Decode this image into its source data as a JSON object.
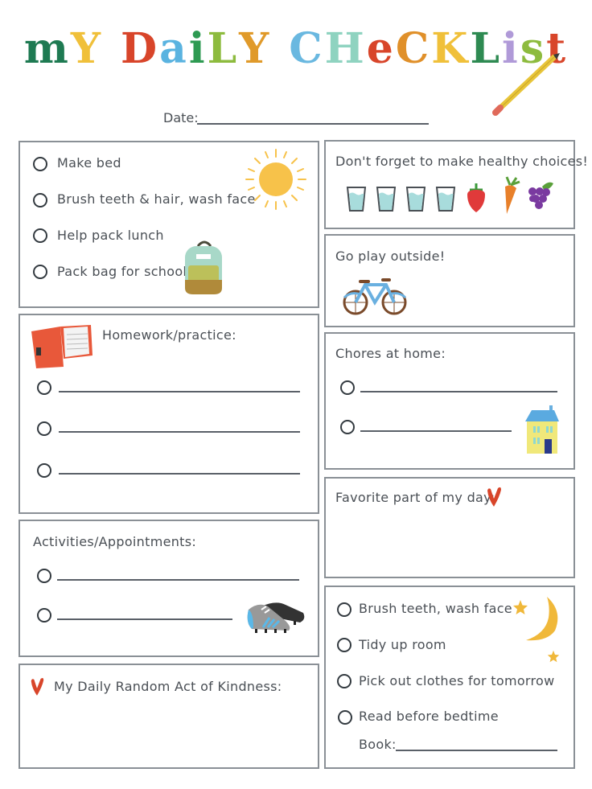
{
  "title": {
    "words": [
      "MY",
      "DaiLY",
      "CHeCKList"
    ],
    "letters": [
      {
        "ch": "m",
        "color": "#1e7a52"
      },
      {
        "ch": "Y",
        "color": "#f0c03a"
      },
      {
        "ch": " ",
        "color": "#000"
      },
      {
        "ch": "D",
        "color": "#d8452a"
      },
      {
        "ch": "a",
        "color": "#5ab3e0"
      },
      {
        "ch": "i",
        "color": "#2e9a52"
      },
      {
        "ch": "L",
        "color": "#8dbb3e"
      },
      {
        "ch": "Y",
        "color": "#e09a2a"
      },
      {
        "ch": " ",
        "color": "#000"
      },
      {
        "ch": "C",
        "color": "#6ab8e0"
      },
      {
        "ch": "H",
        "color": "#8fd3c0"
      },
      {
        "ch": "e",
        "color": "#d8452a"
      },
      {
        "ch": "C",
        "color": "#e0902a"
      },
      {
        "ch": "K",
        "color": "#f0c03a"
      },
      {
        "ch": "L",
        "color": "#2e8a52"
      },
      {
        "ch": "i",
        "color": "#b09ad8"
      },
      {
        "ch": "s",
        "color": "#8dbb3e"
      },
      {
        "ch": "t",
        "color": "#d8452a"
      }
    ]
  },
  "date_label": "Date:",
  "morning": {
    "items": [
      "Make bed",
      "Brush teeth & hair, wash face",
      "Help pack lunch",
      "Pack bag for school"
    ]
  },
  "healthy": {
    "heading": "Don't forget to make healthy choices!",
    "icons": [
      "water-glass",
      "water-glass",
      "water-glass",
      "water-glass",
      "strawberry",
      "carrot",
      "grapes"
    ]
  },
  "outside": {
    "heading": "Go play outside!"
  },
  "homework": {
    "heading": "Homework/practice:",
    "lines": 3
  },
  "chores": {
    "heading": "Chores at home:",
    "lines": 2
  },
  "favorite": {
    "heading": "Favorite part of my day:"
  },
  "activities": {
    "heading": "Activities/Appointments:",
    "lines": 2
  },
  "kindness": {
    "heading": "My Daily Random Act of Kindness:"
  },
  "evening": {
    "items": [
      "Brush teeth, wash face",
      "Tidy up room",
      "Pick out clothes for tomorrow",
      "Read before bedtime"
    ],
    "book_label": "Book:"
  },
  "colors": {
    "border": "#8a9096",
    "text": "#4a4f55",
    "heart": "#d8452a",
    "sun": "#f7c24a"
  }
}
